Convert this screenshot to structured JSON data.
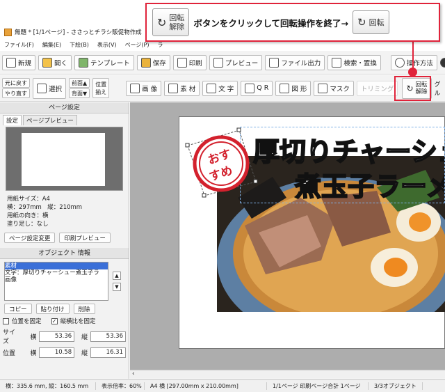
{
  "window": {
    "title": "無題 * [1/1ページ] - ささっとチラシ販促物作成"
  },
  "menu": [
    "ファイル(F)",
    "編集(E)",
    "下絵(B)",
    "表示(V)",
    "ページ(P)",
    "ラ"
  ],
  "toolbar1": {
    "new": "新規",
    "open": "開く",
    "template": "テンプレート",
    "save": "保存",
    "print": "印刷",
    "preview": "プレビュー",
    "export": "ファイル出力",
    "search": "検索・置換",
    "howto": "操作方法"
  },
  "toolbar2": {
    "undo": "元に戻す",
    "redo": "やり直す",
    "select": "選択",
    "front": "前面▲",
    "back": "背面▼",
    "align1": "位置",
    "align2": "揃え",
    "image": "画 像",
    "material": "素 材",
    "text": "文 字",
    "qr": "Q R",
    "shape": "図 形",
    "mask": "マスク",
    "trim": "トリミング",
    "unrotate1": "回転",
    "unrotate2": "解除",
    "group": "グル"
  },
  "callout": {
    "btn1_top": "回転",
    "btn1_bottom": "解除",
    "text": "ボタンをクリックして回転操作を終了→",
    "btn2": "回転"
  },
  "page_settings": {
    "header": "ページ設定",
    "tab_settings": "設定",
    "tab_preview": "ページプレビュー",
    "paper_size": "用紙サイズ：A4",
    "dims": "横：297mm　縦：210mm",
    "orientation": "用紙の向き：横",
    "bleed": "塗り足し：なし",
    "change_btn": "ページ設定変更",
    "print_preview_btn": "印刷プレビュー"
  },
  "object_info": {
    "header": "オブジェクト 情報",
    "items": [
      "素材",
      "文字：厚切りチャーシュー煮玉子ラ",
      "画像"
    ],
    "copy": "コピー",
    "paste": "貼り付け",
    "delete": "削除",
    "lock_pos": "位置を固定",
    "keep_ratio": "縦横比を固定",
    "size_label": "サイズ",
    "pos_label": "位置",
    "w_label": "横",
    "h_label": "縦",
    "size_w": "53.36",
    "size_h": "53.36",
    "pos_x": "10.58",
    "pos_y": "16.31"
  },
  "artwork": {
    "line1": "厚切りチャーシュ",
    "line2": "煮玉子ラーメ",
    "stamp1": "おす",
    "stamp2": "すめ"
  },
  "status": {
    "cursor": "横：335.6 mm, 縦：160.5 mm",
    "zoom": "表示倍率：60%",
    "paper": "A4 横 [297.00mm x 210.00mm]",
    "pages": "1/1ページ 印刷ページ合計 1ページ",
    "objects": "3/3オブジェクト"
  },
  "colors": {
    "accent": "#e0233a",
    "selection": "#3a6fd8"
  }
}
